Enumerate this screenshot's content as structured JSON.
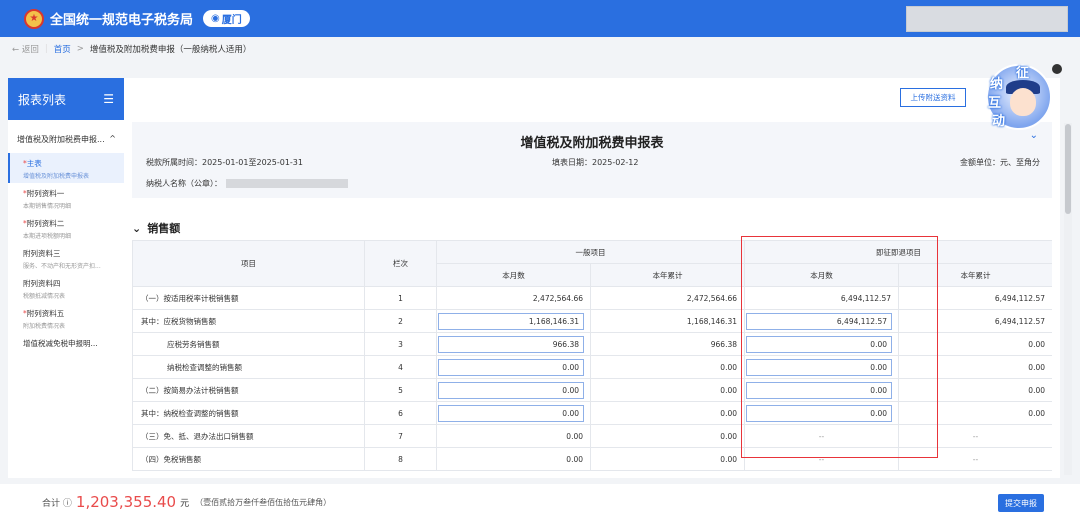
{
  "header": {
    "site_title": "全国统一规范电子税务局",
    "city": "厦门",
    "logo_icon": "tax-emblem-icon",
    "pin_icon": "location-pin-icon"
  },
  "breadcrumb": {
    "back": "← 返回",
    "home": "首页",
    "sep": ">",
    "current": "增值税及附加税费申报（一般纳税人适用）"
  },
  "sidebar": {
    "title": "报表列表",
    "menu_icon": "collapse-menu-icon",
    "group": "增值税及附加税费申报...",
    "group_toggle": "^",
    "items": [
      {
        "title": "主表",
        "sub": "增值税及附加税费申报表",
        "required": true,
        "active": true
      },
      {
        "title": "附列资料一",
        "sub": "本期销售情况明细",
        "required": true,
        "active": false
      },
      {
        "title": "附列资料二",
        "sub": "本期进项税额明细",
        "required": true,
        "active": false
      },
      {
        "title": "附列资料三",
        "sub": "服务、不动产和无形资产扣...",
        "required": false,
        "active": false
      },
      {
        "title": "附列资料四",
        "sub": "税额抵减情况表",
        "required": false,
        "active": false
      },
      {
        "title": "附列资料五",
        "sub": "附加税费情况表",
        "required": true,
        "active": false
      },
      {
        "title": "增值税减免税申报明...",
        "sub": "",
        "required": false,
        "active": false
      }
    ]
  },
  "toolbar": {
    "upload_label": "上传附送资料"
  },
  "form": {
    "title": "增值税及附加税费申报表",
    "period": "税款所属时间：2025-01-01至2025-01-31",
    "fill_date": "填表日期：2025-02-12",
    "unit": "金额单位：元、至角分",
    "taxpayer_label": "纳税人名称（公章）：",
    "collapse_icon": "chevron-down-icon"
  },
  "section": {
    "title": "销售额",
    "icon": "chevron-down-icon"
  },
  "table": {
    "headers": {
      "item": "项目",
      "col_no": "栏次",
      "general": "一般项目",
      "refund": "即征即退项目",
      "month": "本月数",
      "year": "本年累计"
    },
    "rows": [
      {
        "label": "（一）按适用税率计税销售额",
        "no": "1",
        "gm": "2,472,564.66",
        "gy": "2,472,564.66",
        "rm": "6,494,112.57",
        "ry": "6,494,112.57",
        "gm_input": false,
        "rm_input": false,
        "indent": false
      },
      {
        "label": "其中：应税货物销售额",
        "no": "2",
        "gm": "1,168,146.31",
        "gy": "1,168,146.31",
        "rm": "6,494,112.57",
        "ry": "6,494,112.57",
        "gm_input": true,
        "rm_input": true,
        "indent": false
      },
      {
        "label": "应税劳务销售额",
        "no": "3",
        "gm": "966.38",
        "gy": "966.38",
        "rm": "0.00",
        "ry": "0.00",
        "gm_input": true,
        "rm_input": true,
        "indent": true
      },
      {
        "label": "纳税检查调整的销售额",
        "no": "4",
        "gm": "0.00",
        "gy": "0.00",
        "rm": "0.00",
        "ry": "0.00",
        "gm_input": true,
        "rm_input": true,
        "indent": true
      },
      {
        "label": "（二）按简易办法计税销售额",
        "no": "5",
        "gm": "0.00",
        "gy": "0.00",
        "rm": "0.00",
        "ry": "0.00",
        "gm_input": true,
        "rm_input": true,
        "indent": false
      },
      {
        "label": "其中：纳税检查调整的销售额",
        "no": "6",
        "gm": "0.00",
        "gy": "0.00",
        "rm": "0.00",
        "ry": "0.00",
        "gm_input": true,
        "rm_input": true,
        "indent": false
      },
      {
        "label": "（三）免、抵、退办法出口销售额",
        "no": "7",
        "gm": "0.00",
        "gy": "0.00",
        "rm": "--",
        "ry": "--",
        "gm_input": false,
        "rm_input": false,
        "indent": false
      },
      {
        "label": "（四）免税销售额",
        "no": "8",
        "gm": "0.00",
        "gy": "0.00",
        "rm": "--",
        "ry": "--",
        "gm_input": false,
        "rm_input": false,
        "indent": false
      }
    ]
  },
  "mascot": {
    "chars": [
      "纳",
      "征",
      "互",
      "动"
    ]
  },
  "footer": {
    "total_label": "合计",
    "info_icon": "info-circle-icon",
    "total_amount": "1,203,355.40",
    "total_unit": "元",
    "total_words": "（壹佰贰拾万叁仟叁佰伍拾伍元肆角）",
    "submit_label": "提交申报"
  },
  "colors": {
    "primary": "#2a6fe0",
    "highlight_box": "#e8343a",
    "amount": "#e94b4b"
  }
}
